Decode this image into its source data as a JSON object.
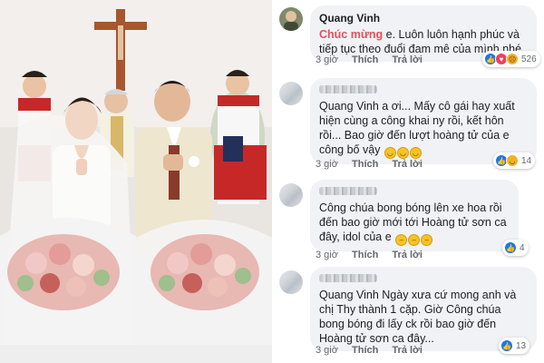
{
  "comments": [
    {
      "author": "Quang Vinh",
      "highlight": "Chúc mừng",
      "text": " e. Luôn luôn hạnh phúc và tiếp tục theo đuổi đam mê của mình nhé",
      "time": "3 giờ",
      "like_label": "Thích",
      "reply_label": "Trả lời",
      "reaction_count": "526",
      "reaction_icons": [
        "like-icon",
        "love-icon",
        "sad-icon"
      ],
      "author_blurred": false
    },
    {
      "author": "",
      "text": "Quang Vinh a ơi... Mấy cô gái hay xuất hiện cùng a công khai ny rồi, kết hôn rồi... Bao giờ đến lượt hoàng tử của e công bố vậy",
      "emojis": [
        "😂",
        "😂",
        "😂"
      ],
      "time": "3 giờ",
      "like_label": "Thích",
      "reply_label": "Trả lời",
      "reaction_count": "14",
      "reaction_icons": [
        "like-icon",
        "haha-icon"
      ],
      "author_blurred": true
    },
    {
      "author": "",
      "text": "Công chúa bong bóng lên xe hoa rồi đến bao giờ mới tới Hoàng tử sơn ca đây, idol của e",
      "emojis": [
        "😶",
        "😶",
        "😶"
      ],
      "time": "3 giờ",
      "like_label": "Thích",
      "reply_label": "Trả lời",
      "reaction_count": "4",
      "reaction_icons": [
        "like-icon"
      ],
      "author_blurred": true
    },
    {
      "author": "",
      "text": "Quang Vinh Ngày xưa cứ mong anh và chị Thy thành 1 cặp. Giờ Công chúa bong bóng đi lấy ck rồi bao giờ đến Hoàng tử sơn ca đây...",
      "time": "3 giờ",
      "like_label": "Thích",
      "reply_label": "Trả lời",
      "reaction_count": "13",
      "reaction_icons": [
        "like-icon"
      ],
      "author_blurred": true
    }
  ],
  "colors": {
    "bubble": "#f0f2f5",
    "highlight": "#e4505a",
    "like": "#1877f2",
    "meta": "#65676b"
  }
}
